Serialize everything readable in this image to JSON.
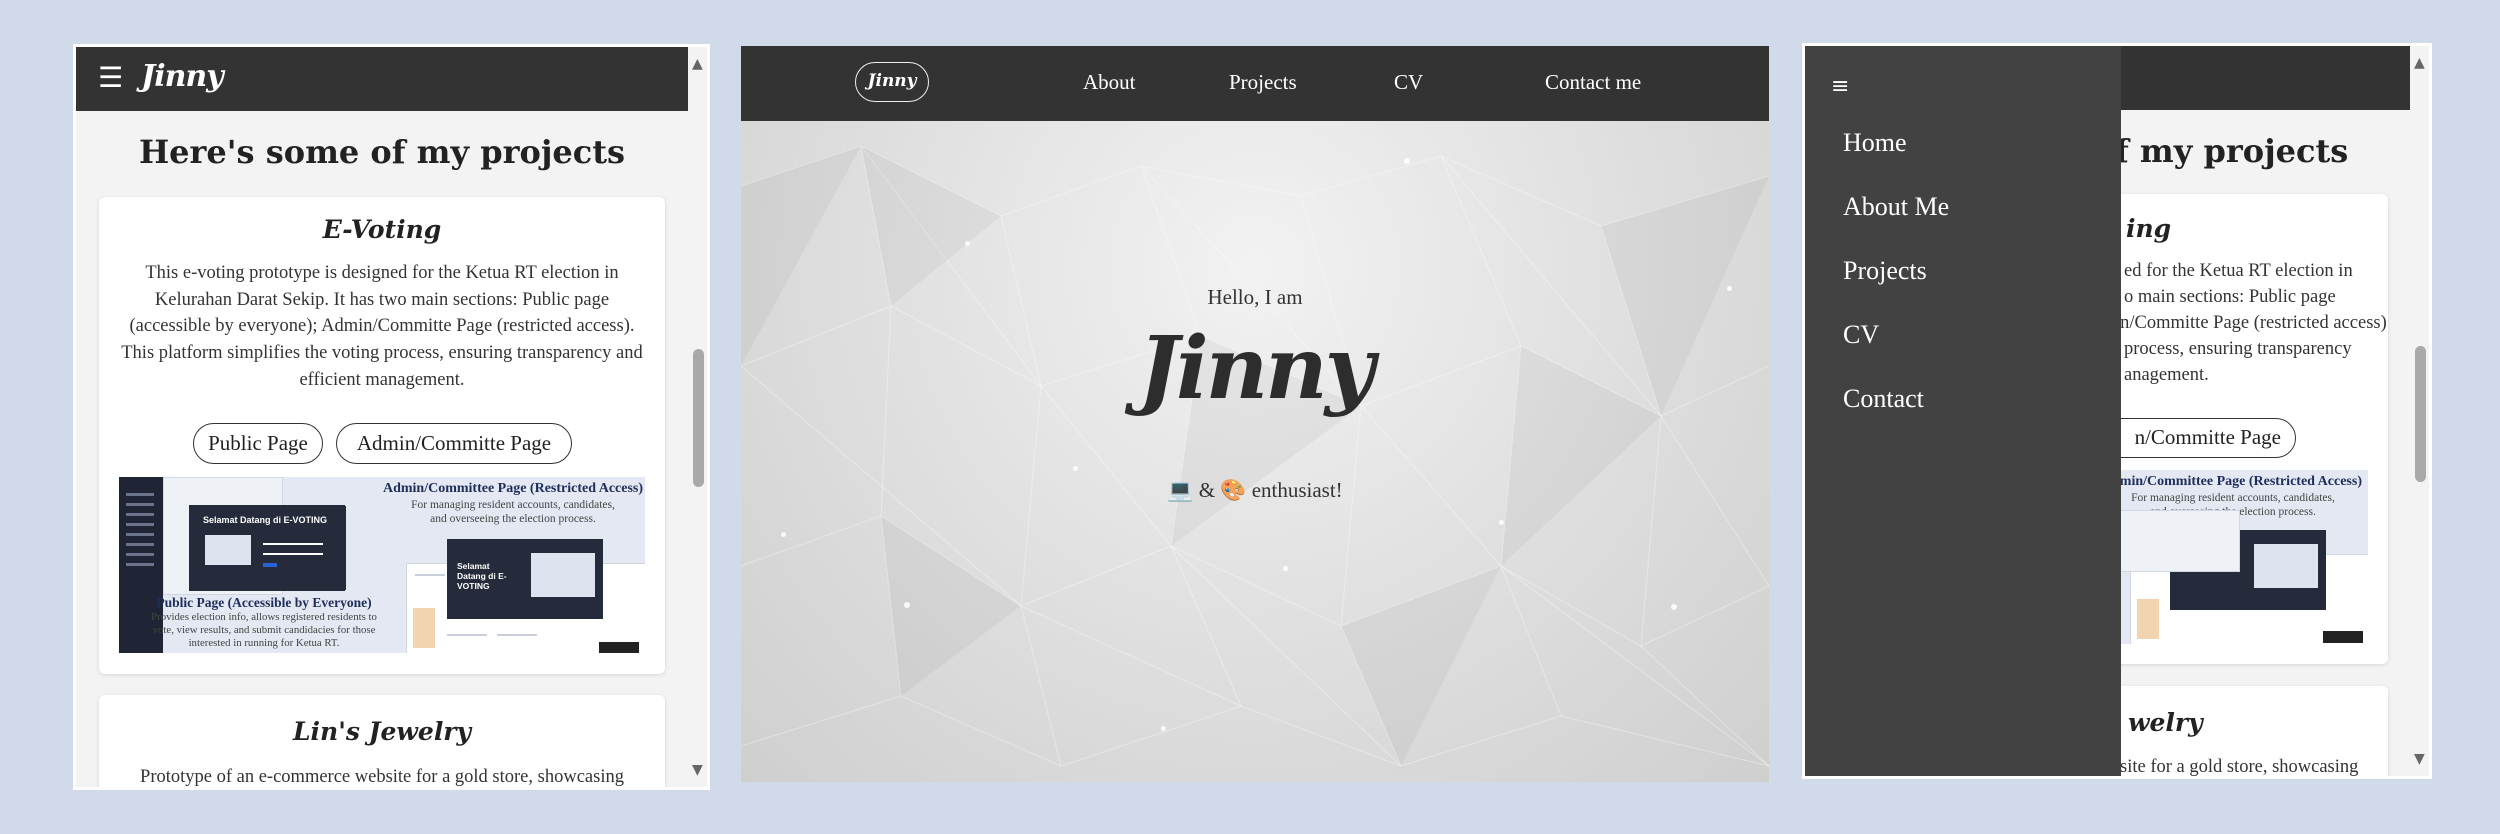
{
  "left_phone": {
    "brand": "Jinny",
    "section_title": "Here's some of my projects",
    "projects": [
      {
        "title": "E-Voting",
        "description": "This e-voting prototype is designed for the Ketua RT election in Kelurahan Darat Sekip. It has two main sections: Public page (accessible by everyone); Admin/Committe Page (restricted access). This platform simplifies the voting process, ensuring transparency and efficient management.",
        "buttons": [
          "Public Page",
          "Admin/Committe Page"
        ],
        "preview": {
          "admin_title": "Admin/Committee Page (Restricted Access)",
          "admin_desc_1": "For managing resident accounts, candidates,",
          "admin_desc_2": "and overseeing the election process.",
          "public_title": "Public Page (Accessible by Everyone)",
          "public_desc_1": "Provides election info, allows registered residents to",
          "public_desc_2": "vote, view results, and submit candidacies for those",
          "public_desc_3": "interested in running for Ketua RT.",
          "login_heading": "Selamat Datang di E-VOTING",
          "welcome_heading": "Selamat Datang di E-VOTING"
        }
      },
      {
        "title": "Lin's Jewelry",
        "description": "Prototype of an e-commerce website for a gold store, showcasing"
      }
    ],
    "scroll_up": "▲",
    "scroll_down": "▼"
  },
  "desktop": {
    "brand": "Jinny",
    "nav": [
      "About",
      "Projects",
      "CV",
      "Contact me"
    ],
    "greeting": "Hello, I am",
    "name": "Jinny",
    "tagline": "💻 & 🎨 enthusiast!"
  },
  "right_phone": {
    "hamburger": "≡",
    "drawer_items": [
      "Home",
      "About Me",
      "Projects",
      "CV",
      "Contact"
    ],
    "section_title_partial": "f my projects",
    "card_title_partial": "ing",
    "desc_lines": [
      "ed for the Ketua RT election in",
      "o main sections: Public page",
      "Admin/Committe Page (restricted access).",
      "process, ensuring transparency",
      "anagement."
    ],
    "button_partial": "n/Committe Page",
    "preview_title_partial": "dmin/Committee Page (Restricted Access)",
    "preview_desc_1": "For managing resident accounts, candidates,",
    "preview_desc_2": "and overseeing the election process.",
    "card2_title_partial": "welry",
    "card2_desc_partial": "site for a gold store, showcasing",
    "scroll_up": "▲",
    "scroll_down": "▼"
  }
}
